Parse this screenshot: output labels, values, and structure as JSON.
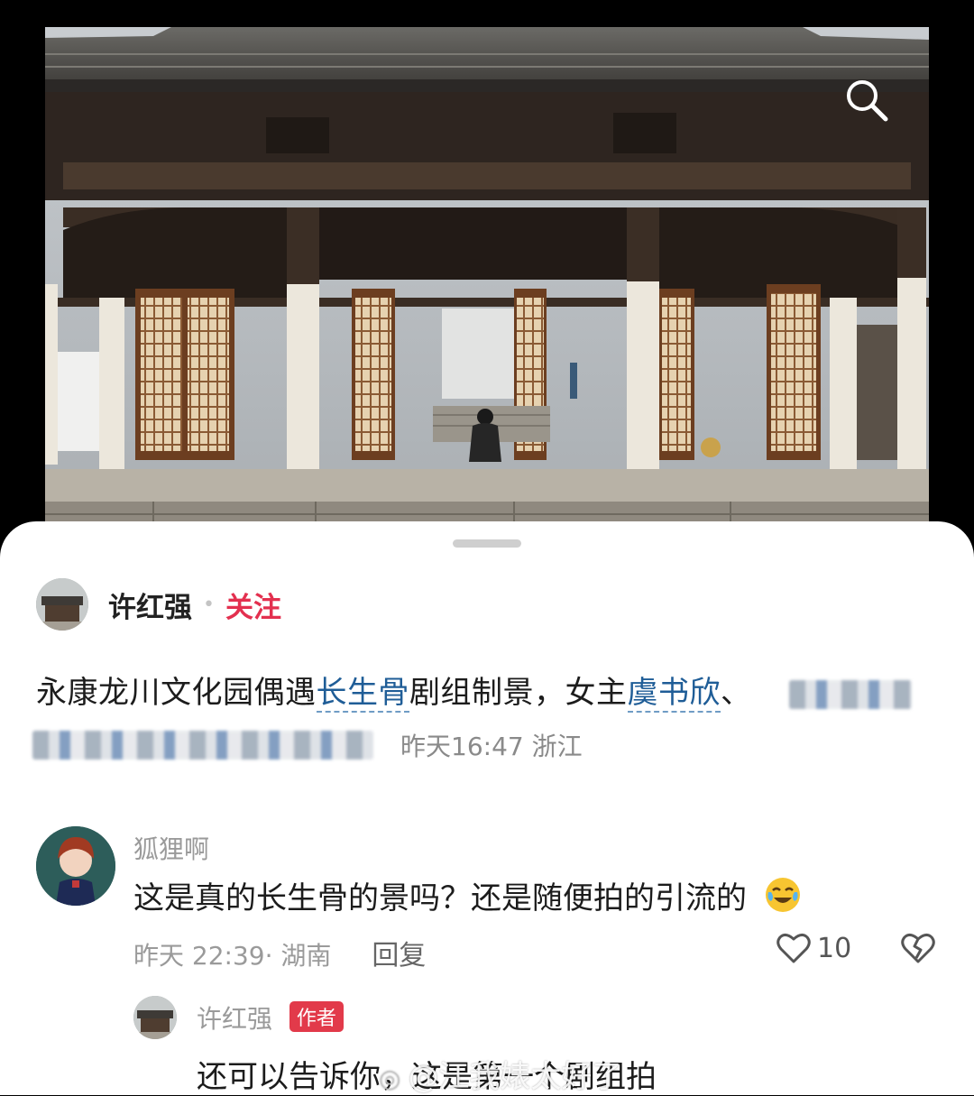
{
  "post": {
    "author": "许红强",
    "follow_label": "关注",
    "text_part1": "永康龙川文化园偶遇",
    "tag1": "长生骨",
    "text_part2": "剧组制景，女主",
    "tag2": "虞书欣",
    "text_part3": "、",
    "meta": "昨天16:47 浙江"
  },
  "comment": {
    "username": "狐狸啊",
    "text": "这是真的长生骨的景吗？还是随便拍的引流的",
    "emoji": "crying-laughing-emoji",
    "time_location": "昨天 22:39· 湖南",
    "reply_label": "回复",
    "like_count": "10"
  },
  "reply": {
    "username": "许红强",
    "badge": "作者",
    "text": "还可以告诉你，这是第一个剧组拍"
  },
  "watermark": "@江我婊太好了",
  "icons": {
    "search": "search-icon",
    "like": "heart-icon",
    "dislike": "broken-heart-icon"
  },
  "colors": {
    "accent_red": "#e3304f",
    "tag_blue": "#1f5d97",
    "author_badge": "#e23a4a"
  }
}
